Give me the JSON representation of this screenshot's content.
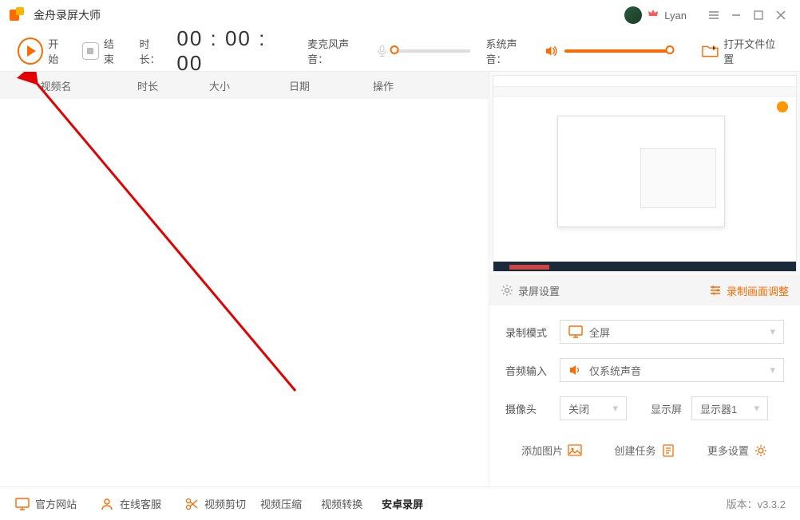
{
  "titlebar": {
    "app_name": "金舟录屏大师",
    "username": "Lyan"
  },
  "toolbar": {
    "start": "开始",
    "end": "结束",
    "duration_label": "时长：",
    "timer": "00 : 00 : 00",
    "mic_label": "麦克风声音：",
    "system_label": "系统声音：",
    "open_folder": "打开文件位置"
  },
  "table": {
    "headers": [
      "视频名",
      "时长",
      "大小",
      "日期",
      "操作"
    ]
  },
  "settings": {
    "header": "录屏设置",
    "adjust": "录制画面调整",
    "record_mode": {
      "label": "录制模式",
      "value": "全屏"
    },
    "audio_input": {
      "label": "音频输入",
      "value": "仅系统声音"
    },
    "camera": {
      "label": "摄像头",
      "value": "关闭"
    },
    "display": {
      "label": "显示屏",
      "value": "显示器1"
    },
    "actions": {
      "add_image": "添加图片",
      "create_task": "创建任务",
      "more_settings": "更多设置"
    }
  },
  "footer": {
    "official": "官方网站",
    "service": "在线客服",
    "video_cut": "视频剪切",
    "video_compress": "视频压缩",
    "video_convert": "视频转换",
    "android_record": "安卓录屏",
    "version_label": "版本：",
    "version": "v3.3.2"
  }
}
